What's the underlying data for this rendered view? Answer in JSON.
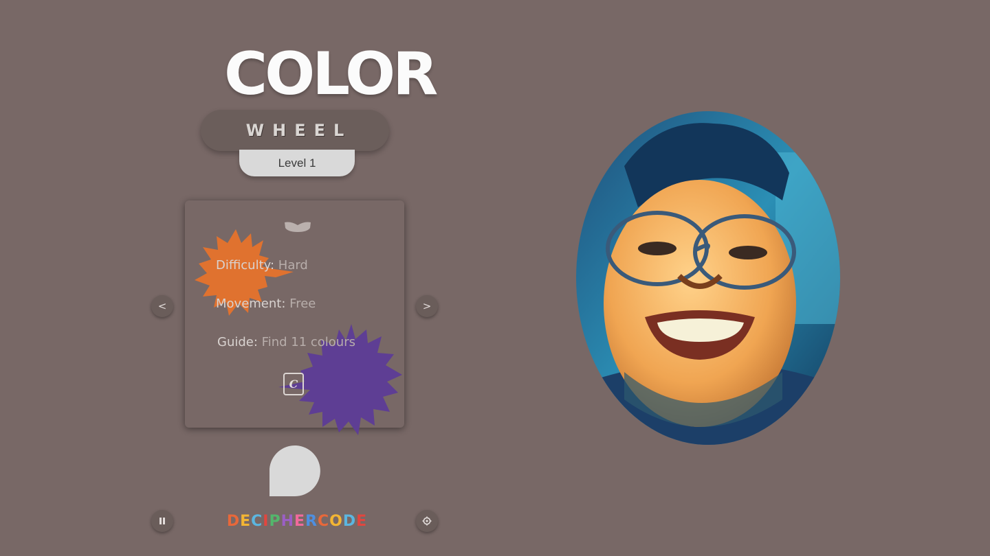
{
  "header": {
    "title": "COLOR",
    "subtitle": "WHEEL",
    "level": "Level 1"
  },
  "card": {
    "mask_icon": "mask-icon",
    "difficulty_label": "Difficulty:",
    "difficulty_value": "Hard",
    "movement_label": "Movement:",
    "movement_value": "Free",
    "guide_label": "Guide:",
    "guide_value": "Find 11 colours",
    "key_hint": "C"
  },
  "nav": {
    "prev": "<",
    "next": ">"
  },
  "controls": {
    "pause_icon": "pause-icon",
    "settings_icon": "gear-icon"
  },
  "brand": {
    "text": "DECIPHER CODE",
    "colors": [
      "#e8683a",
      "#f3b533",
      "#5bb6e0",
      "#e1463f",
      "#53b66c",
      "#9b5fc4",
      "#f06a9c",
      "#4e8fe0"
    ]
  },
  "colors": {
    "background": "#786866",
    "splat_orange": "#e0722f",
    "splat_purple": "#5e3e94",
    "player_blob": "#d9d9d9"
  }
}
